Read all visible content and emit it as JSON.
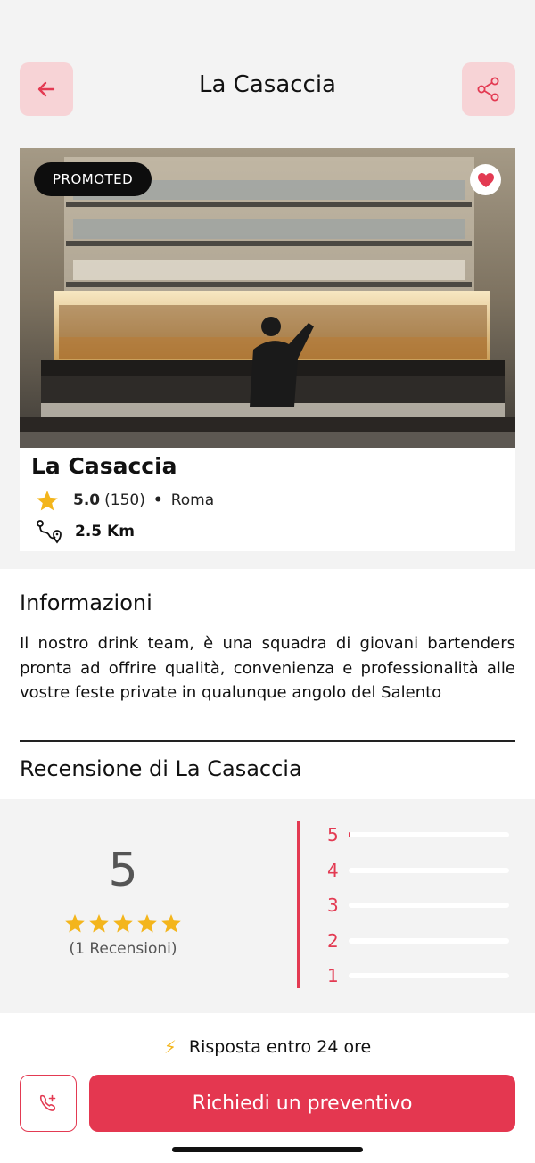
{
  "header": {
    "title": "La Casaccia",
    "back_icon": "arrow-left-icon",
    "share_icon": "share-icon"
  },
  "hero": {
    "badge": "PROMOTED",
    "favorite": true,
    "photo": "bar-counter-with-bottles"
  },
  "venue": {
    "name": "La Casaccia",
    "rating": "5.0",
    "rating_count": "(150)",
    "separator": "•",
    "city": "Roma",
    "distance": "2.5 Km"
  },
  "info": {
    "title": "Informazioni",
    "text": "Il nostro drink team, è una squadra di giovani bartenders pronta ad offrire qualità, convenienza e professionalità alle vostre feste private in qualunque angolo del Salento"
  },
  "reviews": {
    "title": "Recensione di La Casaccia",
    "score": "5",
    "stars": 5,
    "count_label": "(1 Recensioni)",
    "distribution": [
      {
        "label": "5",
        "fraction": 0.01
      },
      {
        "label": "4",
        "fraction": 0
      },
      {
        "label": "3",
        "fraction": 0
      },
      {
        "label": "2",
        "fraction": 0
      },
      {
        "label": "1",
        "fraction": 0
      }
    ]
  },
  "footer": {
    "response_text": "Risposta entro 24 ore",
    "call_icon": "phone-add-icon",
    "quote_label": "Richiedi un preventivo"
  },
  "colors": {
    "accent": "#e43750",
    "accent_light": "#f7d3d6",
    "star": "#f3b51c",
    "badge_bg": "#0d0d0d"
  }
}
